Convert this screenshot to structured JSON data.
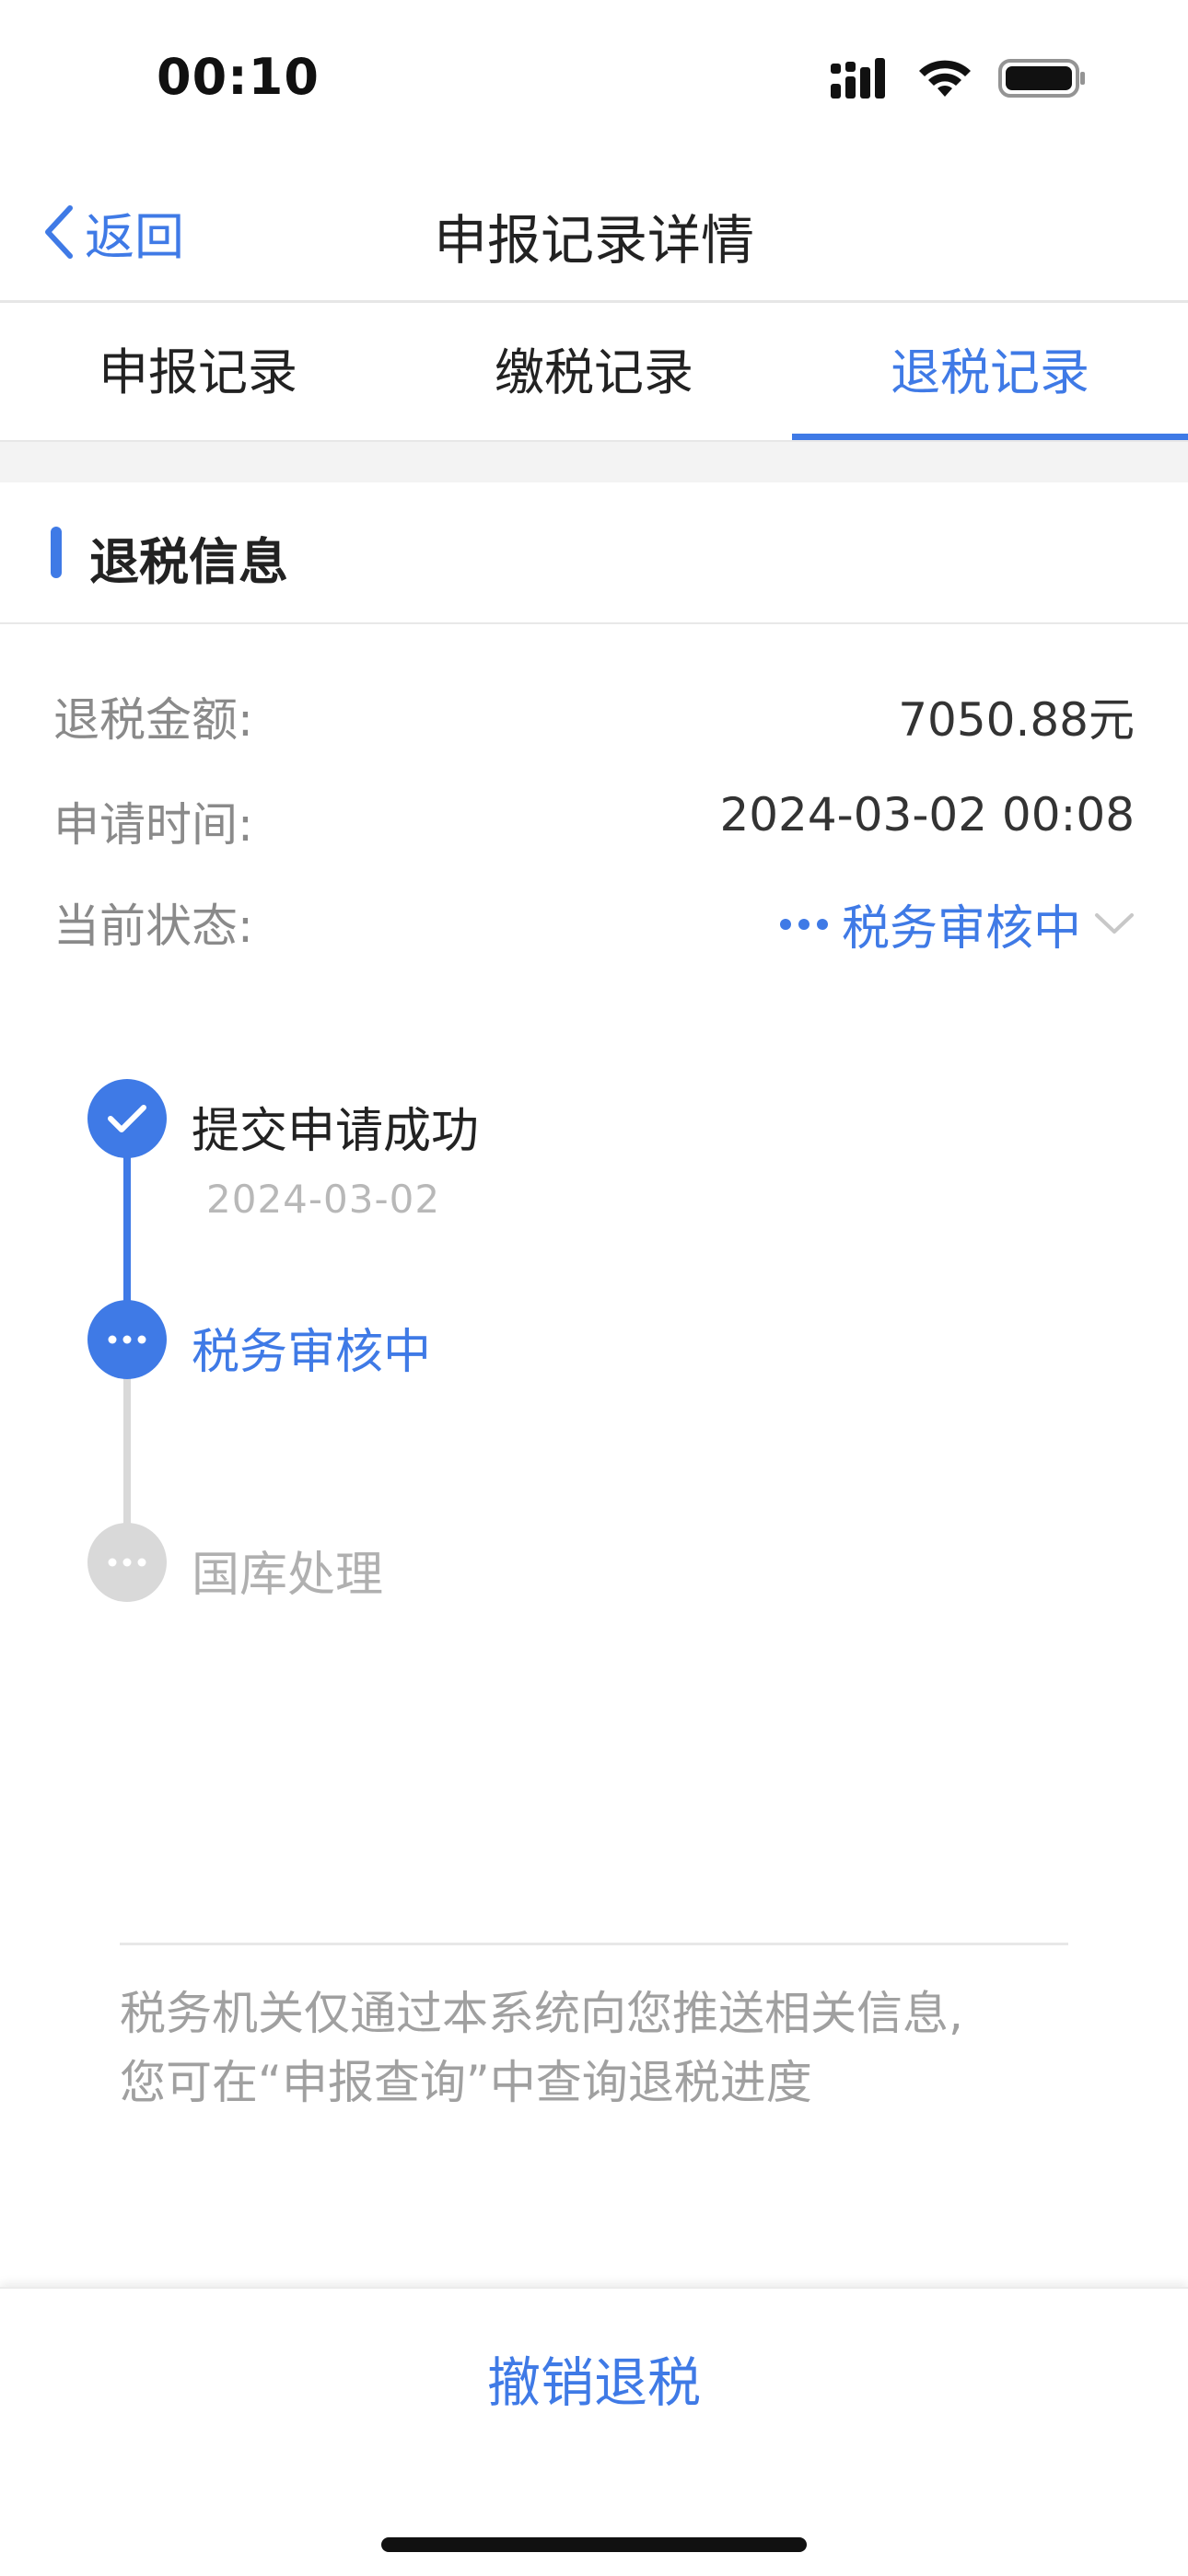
{
  "status_bar": {
    "time": "00:10",
    "icons": [
      "signal-icon",
      "wifi-icon",
      "battery-icon"
    ]
  },
  "nav": {
    "back_label": "返回",
    "title": "申报记录详情"
  },
  "tabs": [
    {
      "label": "申报记录",
      "active": false
    },
    {
      "label": "缴税记录",
      "active": false
    },
    {
      "label": "退税记录",
      "active": true
    }
  ],
  "section": {
    "title": "退税信息"
  },
  "info_rows": {
    "amount_label": "退税金额:",
    "amount_value": "7050.88元",
    "time_label": "申请时间:",
    "time_value": "2024-03-02 00:08",
    "status_label": "当前状态:",
    "status_value": "税务审核中"
  },
  "timeline": [
    {
      "title": "提交申请成功",
      "date": "2024-03-02",
      "state": "done"
    },
    {
      "title": "税务审核中",
      "date": "",
      "state": "current"
    },
    {
      "title": "国库处理",
      "date": "",
      "state": "pending"
    }
  ],
  "note": {
    "line1": "税务机关仅通过本系统向您推送相关信息,",
    "line2": "您可在“申报查询”中查询退税进度"
  },
  "bottom": {
    "cancel_label": "撤销退税"
  },
  "colors": {
    "accent": "#3f7ae6",
    "pending": "#d9d9d9",
    "label_gray": "#8a8a8a"
  }
}
